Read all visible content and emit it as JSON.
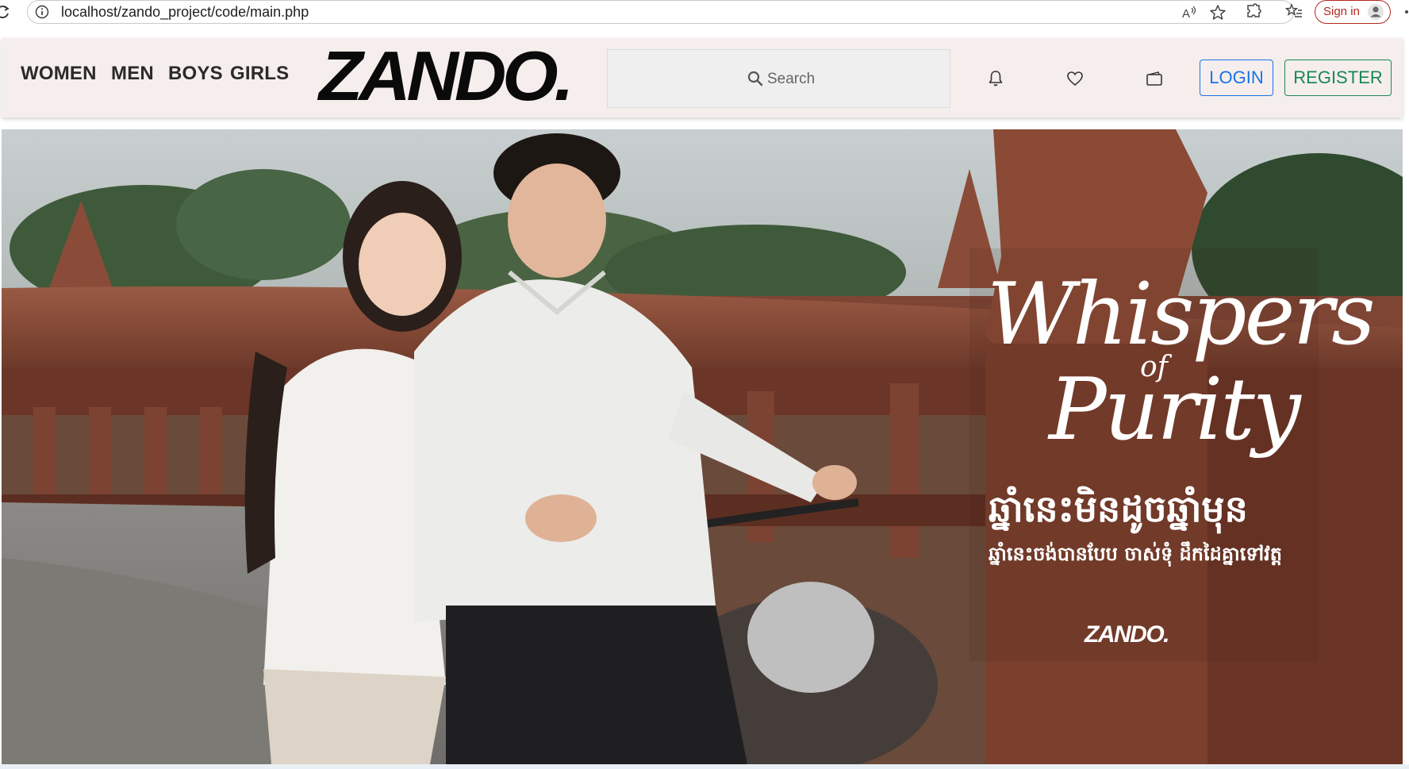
{
  "browser": {
    "url": "localhost/zando_project/code/main.php",
    "sign_in_label": "Sign in"
  },
  "header": {
    "nav": [
      "WOMEN",
      "MEN",
      "BOYS",
      "GIRLS"
    ],
    "logo": "ZANDO.",
    "search_placeholder": "Search",
    "login_label": "LOGIN",
    "register_label": "REGISTER",
    "colors": {
      "header_bg": "#f5eeec",
      "login": "#1a73e8",
      "register": "#198754"
    }
  },
  "hero": {
    "title_line1": "Whispers",
    "title_of": "of",
    "title_line2": "Purity",
    "khmer_headline": "ឆ្នាំនេះមិនដូចឆ្នាំមុន",
    "khmer_subline": "ឆ្នាំនេះចង់បានបែប ចាស់ទុំ ដឹកដៃគ្នាទៅវត្ត",
    "brand": "ZANDO."
  }
}
